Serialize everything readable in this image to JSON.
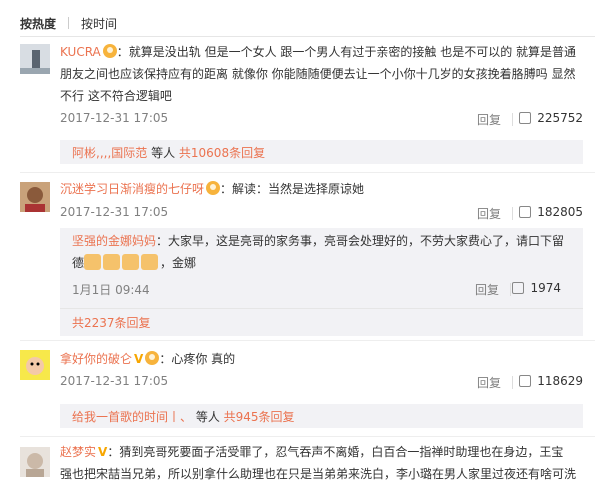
{
  "tabs": {
    "hot": "按热度",
    "time": "按时间"
  },
  "comments": [
    {
      "username": "KUCRA",
      "text_line1": "：就算是没出轨 但是一个女人 跟一个男人有过于亲密的接触 也是不可以的 就算是普通",
      "text_line2": "朋友之间也应该保持应有的距离 就像你 你能随随便便去让一个小你十几岁的女孩挽着胳膊吗 显然",
      "text_line3": "不行 这不符合逻辑吧",
      "time": "2017-12-31 17:05",
      "reply": "回复",
      "likes": "225752",
      "sub_names": "阿彬,,,,国际范",
      "sub_mid": " 等人 ",
      "sub_count": "共10608条回复"
    },
    {
      "username": "沉迷学习日渐消瘦的七仔呀",
      "text": "：解读：当然是选择原谅她",
      "time": "2017-12-31 17:05",
      "reply": "回复",
      "likes": "182805",
      "reply_item": {
        "username": "坚强的金娜妈妈",
        "text_line1": "：大家早，这是亮哥的家务事，亮哥会处理好的，不劳大家费心了，请口下留",
        "text_line2a": "德",
        "text_line2b": "，金娜",
        "time": "1月1日 09:44",
        "reply": "回复",
        "likes": "1974"
      },
      "sub_count": "共2237条回复"
    },
    {
      "username": "拿好你的破仑",
      "text": "：心疼你 真的",
      "time": "2017-12-31 17:05",
      "reply": "回复",
      "likes": "118629",
      "sub_names": "给我一首歌的时间丨、",
      "sub_mid": " 等人 ",
      "sub_count": "共945条回复"
    },
    {
      "username": "赵梦实",
      "text_line1": "：猜到亮哥死要面子活受罪了，忍气吞声不离婚，白百合一指禅时助理也在身边，王宝",
      "text_line2": "强也把宋喆当兄弟，所以别拿什么助理也在只是当弟弟来洗白，李小璐在男人家里过夜还有啥可洗"
    }
  ],
  "colors": {
    "link": "#eb7350",
    "meta": "#808080",
    "subbox": "#f2f2f5"
  }
}
